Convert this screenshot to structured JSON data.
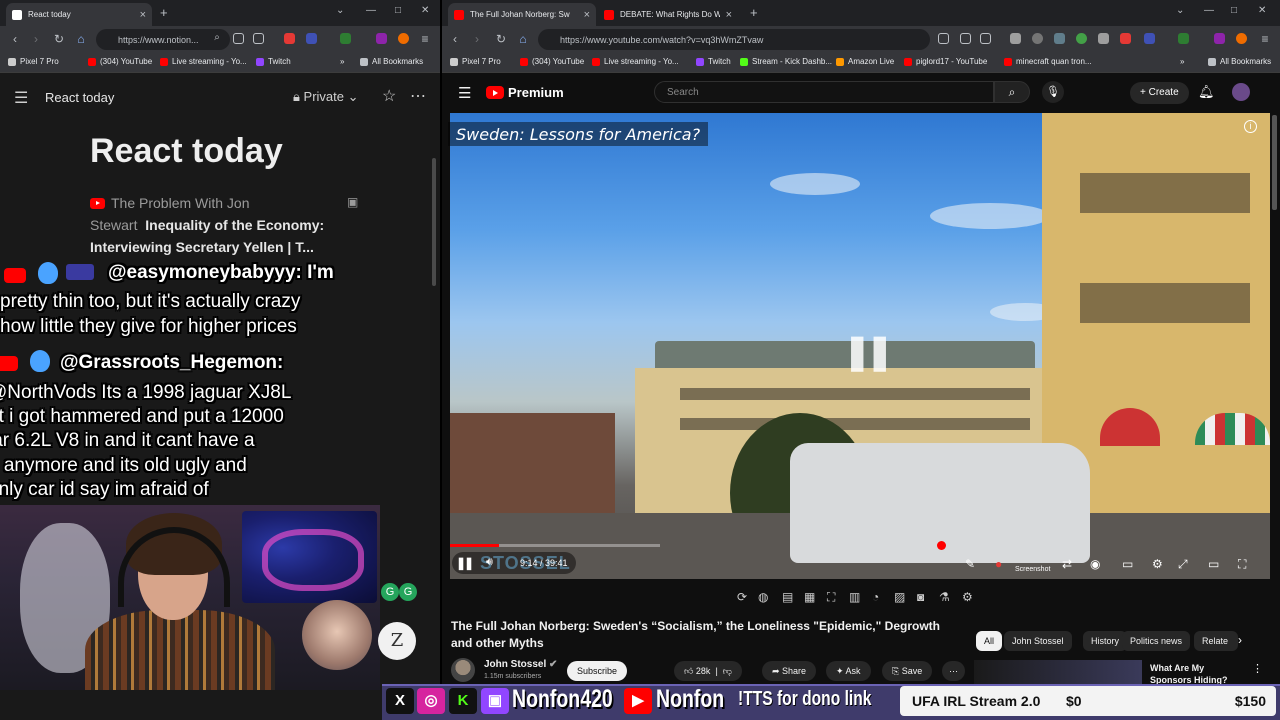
{
  "left_window": {
    "tab_title": "React today",
    "url": "https://www.notion...",
    "bookmarks": [
      "Pixel 7 Pro",
      "(304) YouTube",
      "Live streaming - Yo...",
      "Twitch",
      "»",
      "All Bookmarks"
    ],
    "page": {
      "breadcrumb": "React today",
      "share": "Private",
      "title": "React today",
      "entry1_channel": "The Problem With Jon",
      "entry1_channel2": "Stewart",
      "entry1_title": "Inequality of the Economy:",
      "entry1_title2": "Interviewing Secretary Yellen | T..."
    }
  },
  "chat": [
    {
      "text": "@easymoneybabyyy: I'm",
      "name": true
    },
    {
      "text": "pretty thin too, but it's actually crazy",
      "name": false
    },
    {
      "text": "how little they give for higher prices",
      "name": false
    },
    {
      "text": "@Grassroots_Hegemon:",
      "name": true
    },
    {
      "text": "@NorthVods Its a 1998 jaguar XJ8L",
      "name": false
    },
    {
      "text": "at i got hammered and put a 12000",
      "name": false
    },
    {
      "text": "lar 6.2L V8 in and it cant have a",
      "name": false
    },
    {
      "text": "d anymore and its old ugly and",
      "name": false
    },
    {
      "text": "only car id say im afraid of",
      "name": false
    }
  ],
  "right_window": {
    "tab1_title": "The Full Johan Norberg: Sw",
    "tab2_title": "DEBATE: What Rights Do We H",
    "url": "https://www.youtube.com/watch?v=vq3hWmZTvaw",
    "bookmarks": [
      "Pixel 7 Pro",
      "(304) YouTube",
      "Live streaming - Yo...",
      "Twitch",
      "Stream - Kick Dashb...",
      "Amazon Live",
      "piglord17 - YouTube",
      "minecraft quan tron...",
      "»",
      "All Bookmarks"
    ],
    "yt": {
      "logo": "Premium",
      "search_placeholder": "Search",
      "create": "Create",
      "video_overlay_title": "Sweden: Lessons for America?",
      "watermark": "STOSSEL",
      "time": "9:14 / 39:41",
      "progress": 0.233,
      "screenshot_label": "Screenshot",
      "title": "The Full Johan Norberg: Sweden's “Socialism,” the Loneliness \"Epidemic,\" Degrowth and other Myths",
      "channel": "John Stossel",
      "subscribers": "1.15m subscribers",
      "subscribe": "Subscribe",
      "likes": "28k",
      "share": "Share",
      "ask": "Ask",
      "save": "Save",
      "chips": [
        "All",
        "John Stossel",
        "History",
        "Politics news",
        "Relate"
      ],
      "rec_title": "What Are My Sponsors Hiding?"
    }
  },
  "stream_bar": {
    "handle": "Nonfon420",
    "yt_name": "Nonfon",
    "tts": "!TTS for dono link",
    "goal_title": "UFA IRL Stream 2.0",
    "goal_current": "$0",
    "goal_target": "$150"
  }
}
